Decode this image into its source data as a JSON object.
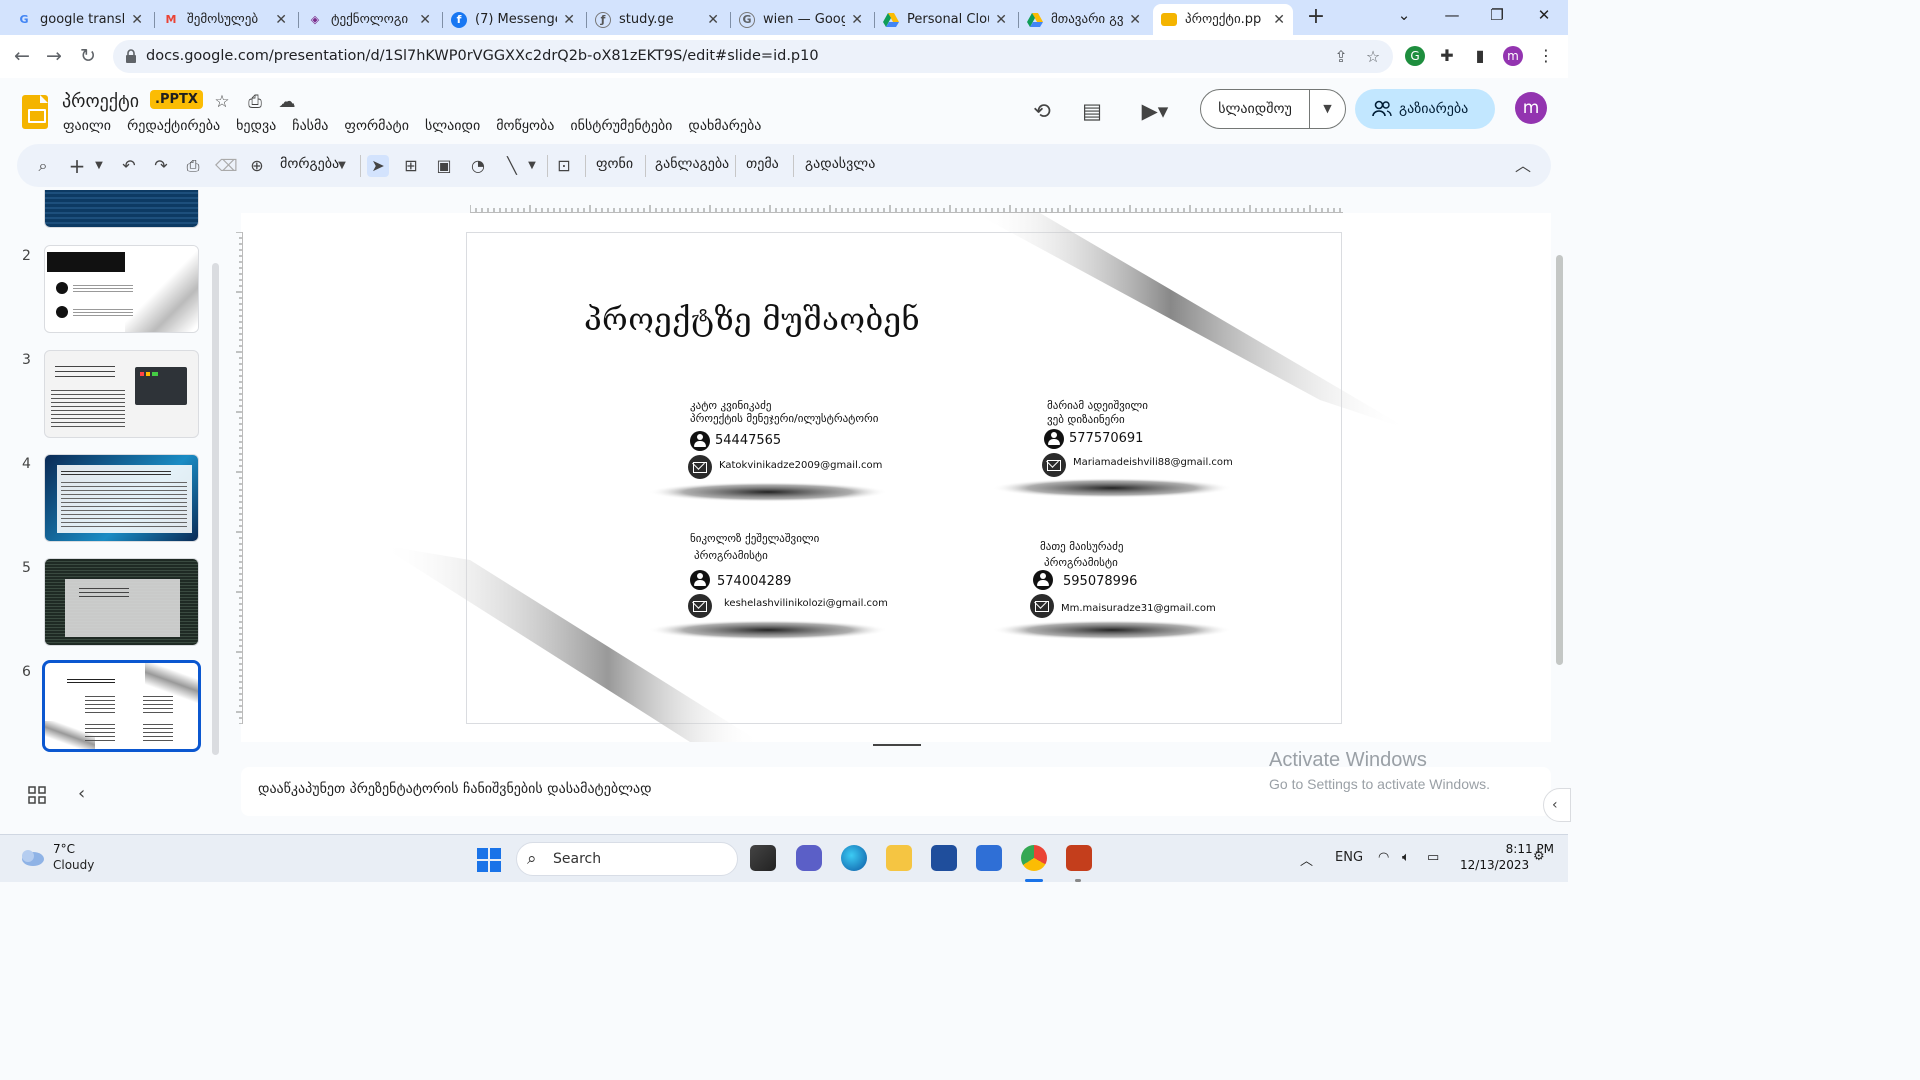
{
  "browser": {
    "tabs": [
      {
        "title": "google transl",
        "icon": "google-g-icon",
        "color": "#4285f4",
        "glyph": "G"
      },
      {
        "title": "შემოსულებ",
        "icon": "gmail-icon",
        "color": "#ea4335",
        "glyph": "M"
      },
      {
        "title": "ტექნოლოგი",
        "icon": "owl-icon",
        "color": "#7b2a8a",
        "glyph": "◈"
      },
      {
        "title": "(7) Messenge",
        "icon": "facebook-icon",
        "color": "#1877f2",
        "glyph": "f"
      },
      {
        "title": "study.ge",
        "icon": "study-icon",
        "color": "#555555",
        "glyph": "ƒ"
      },
      {
        "title": "wien — Goog",
        "icon": "google-search-icon",
        "color": "#5f6368",
        "glyph": "G"
      },
      {
        "title": "Personal Clou",
        "icon": "drive-icon",
        "color": "#0f9d58",
        "glyph": "▲"
      },
      {
        "title": "მთავარი გვ",
        "icon": "drive-icon",
        "color": "#0f9d58",
        "glyph": "▲"
      },
      {
        "title": "პროექტი.pp",
        "icon": "slides-icon",
        "color": "#f4b400",
        "glyph": "▭",
        "active": true
      }
    ],
    "url": "docs.google.com/presentation/d/1Sl7hKWP0rVGGXXc2drQ2b-oX81zEKT9S/edit#slide=id.p10",
    "profile_initial": "m"
  },
  "doc": {
    "title": "პროექტი",
    "badge": ".PPTX",
    "menu": [
      "ფაილი",
      "რედაქტირება",
      "ხედვა",
      "ჩასმა",
      "ფორმატი",
      "სლაიდი",
      "მოწყობა",
      "ინსტრუმენტები",
      "დახმარება"
    ],
    "slideshow_label": "სლაიდშოუ",
    "share_label": "გაზიარება",
    "user_initial": "m"
  },
  "toolbar": {
    "zoom_label": "მორგება",
    "background_label": "ფონი",
    "layout_label": "განლაგება",
    "theme_label": "თემა",
    "transition_label": "გადასვლა"
  },
  "filmstrip": {
    "numbers": [
      "2",
      "3",
      "4",
      "5",
      "6"
    ],
    "selected": "6"
  },
  "slide": {
    "title": "პროექტზე მუშაობენ",
    "members": [
      {
        "name": "კატო კვინიკაძე",
        "role": "პროექტის მენეჯერი/ილუსტრატორი",
        "phone": "54447565",
        "email": "Katokvinikadze2009@gmail.com"
      },
      {
        "name": "მარიამ ადეიშვილი",
        "role": "ვებ დიზაინერი",
        "phone": "577570691",
        "email": "Mariamadeishvili88@gmail.com"
      },
      {
        "name": "ნიკოლოზ ქეშელაშვილი",
        "role": "პროგრამისტი",
        "phone": "574004289",
        "email": "keshelashvilinikolozi@gmail.com"
      },
      {
        "name": "მათე მაისურაძე",
        "role": "პროგრამისტი",
        "phone": "595078996",
        "email": "Mm.maisuradze31@gmail.com"
      }
    ]
  },
  "notes": {
    "placeholder": "დააწკაპუნეთ პრეზენტატორის ჩანიშვნების დასამატებლად"
  },
  "watermark": {
    "title": "Activate Windows",
    "subtitle": "Go to Settings to activate Windows."
  },
  "taskbar": {
    "weather_temp": "7°C",
    "weather_desc": "Cloudy",
    "search_label": "Search",
    "language": "ENG",
    "time": "8:11 PM",
    "date": "12/13/2023"
  },
  "colors": {
    "accent": "#0b57d0",
    "share_bg": "#c2e7ff",
    "slides_yellow": "#f4b400",
    "avatar": "#9334b0"
  }
}
